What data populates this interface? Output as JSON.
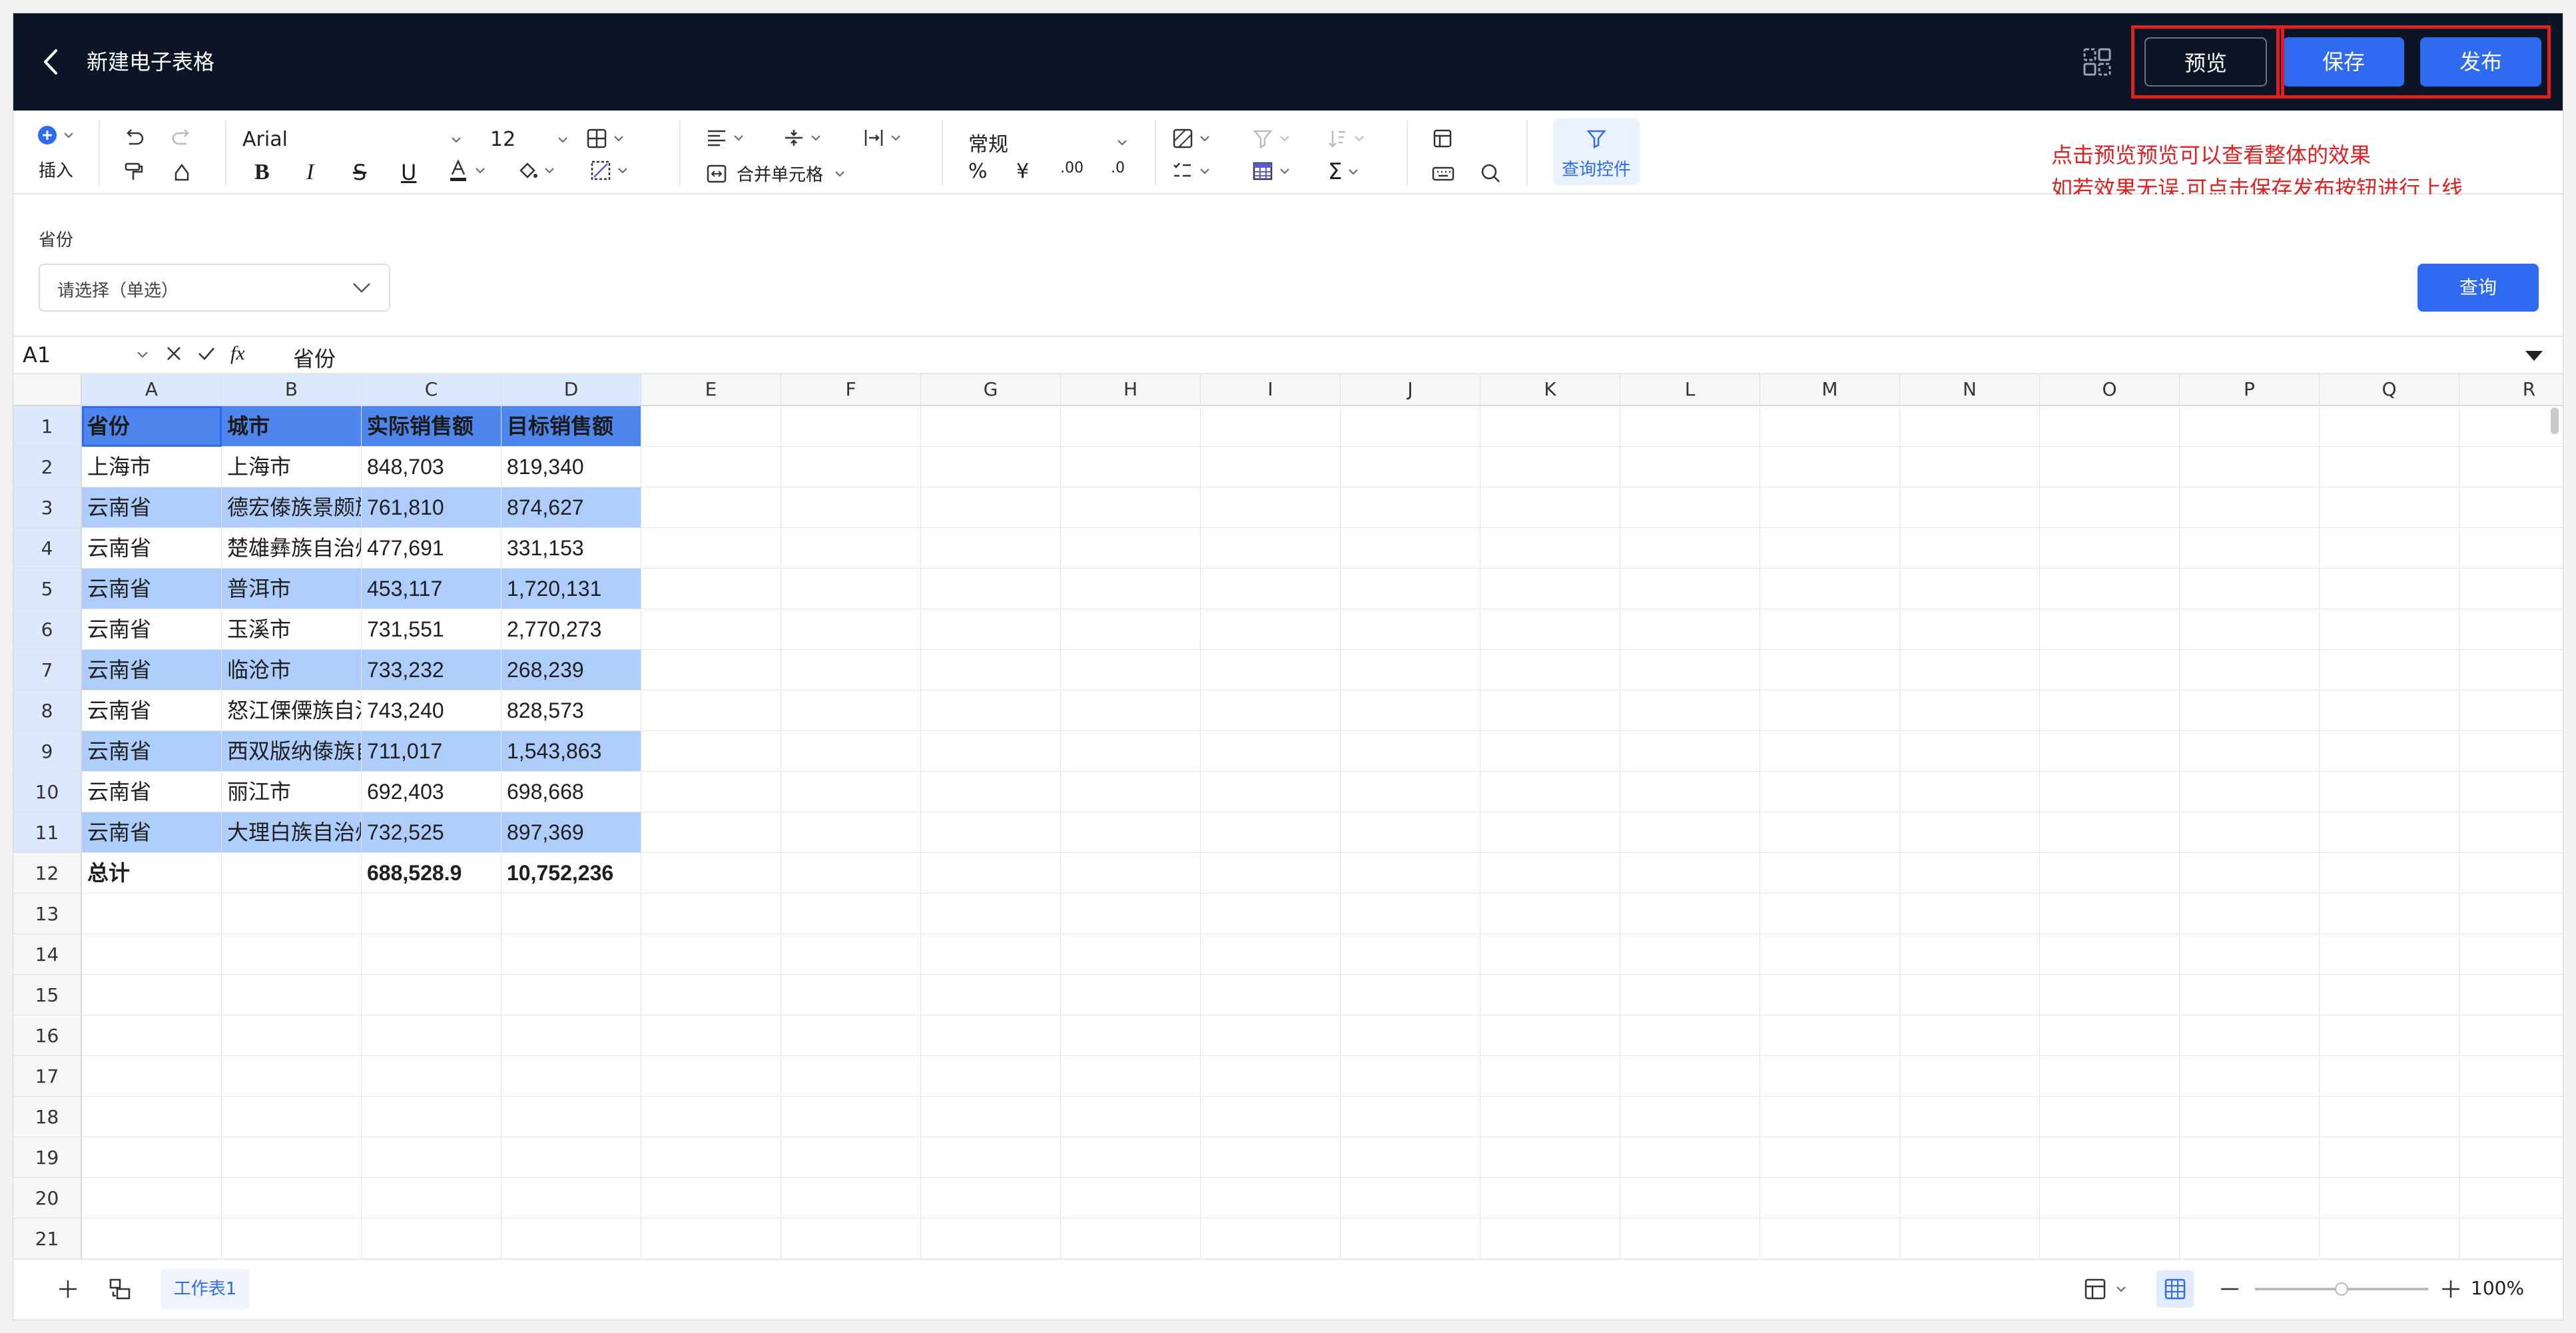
{
  "header": {
    "title": "新建电子表格",
    "preview_label": "预览",
    "save_label": "保存",
    "publish_label": "发布"
  },
  "toolbar": {
    "insert_label": "插入",
    "font_family": "Arial",
    "font_size": "12",
    "merge_label": "合并单元格",
    "number_format": "常规",
    "query_control_label": "查询控件"
  },
  "annotation": {
    "line1": "点击预览预览可以查看整体的效果",
    "line2": "如若效果无误,可点击保存发布按钮进行上线"
  },
  "filter": {
    "label": "省份",
    "placeholder": "请选择（单选）",
    "query_button": "查询"
  },
  "formula_bar": {
    "cell_ref": "A1",
    "value": "省份",
    "fx_label": "fx"
  },
  "grid": {
    "columns": [
      "A",
      "B",
      "C",
      "D",
      "E",
      "F",
      "G",
      "H",
      "I",
      "J",
      "K",
      "L",
      "M",
      "N",
      "O",
      "P",
      "Q",
      "R"
    ],
    "row_numbers": [
      "1",
      "2",
      "3",
      "4",
      "5",
      "6",
      "7",
      "8",
      "9",
      "10",
      "11",
      "12",
      "13",
      "14",
      "15",
      "16",
      "17",
      "18",
      "19",
      "20",
      "21"
    ],
    "rows": [
      [
        "省份",
        "城市",
        "实际销售额",
        "目标销售额"
      ],
      [
        "上海市",
        "上海市",
        "848,703",
        "819,340"
      ],
      [
        "云南省",
        "德宏傣族景颇族自治州",
        "761,810",
        "874,627"
      ],
      [
        "云南省",
        "楚雄彝族自治州",
        "477,691",
        "331,153"
      ],
      [
        "云南省",
        "普洱市",
        "453,117",
        "1,720,131"
      ],
      [
        "云南省",
        "玉溪市",
        "731,551",
        "2,770,273"
      ],
      [
        "云南省",
        "临沧市",
        "733,232",
        "268,239"
      ],
      [
        "云南省",
        "怒江傈僳族自治州",
        "743,240",
        "828,573"
      ],
      [
        "云南省",
        "西双版纳傣族自治州",
        "711,017",
        "1,543,863"
      ],
      [
        "云南省",
        "丽江市",
        "692,403",
        "698,668"
      ],
      [
        "云南省",
        "大理白族自治州",
        "732,525",
        "897,369"
      ],
      [
        "总计",
        "",
        "688,528.9",
        "10,752,236"
      ]
    ]
  },
  "bottom": {
    "sheet_tab": "工作表1",
    "zoom": "100%"
  },
  "colors": {
    "header_bg": "#0c1526",
    "primary": "#2f6bf0",
    "annotation": "#e02020",
    "table_header": "#4f86ee",
    "table_band": "#afcdfb"
  }
}
